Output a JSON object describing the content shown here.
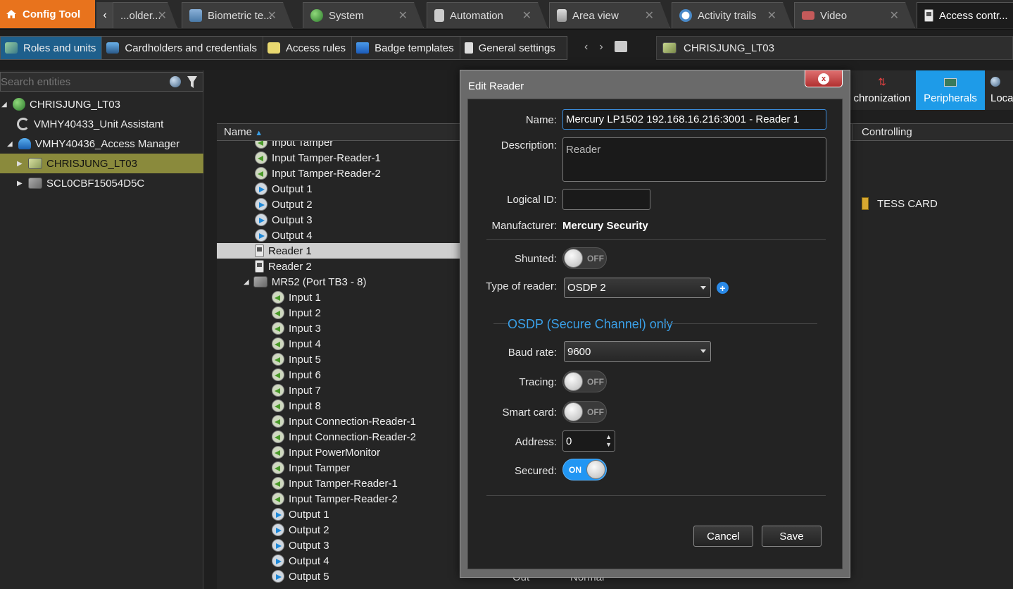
{
  "app": {
    "title": "Config Tool"
  },
  "tabs": [
    {
      "label": "...older...",
      "icon": "folder-icon"
    },
    {
      "label": "Biometric te...",
      "icon": "image-icon"
    },
    {
      "label": "System",
      "icon": "globe-icon"
    },
    {
      "label": "Automation",
      "icon": "automation-icon"
    },
    {
      "label": "Area view",
      "icon": "area-view-icon"
    },
    {
      "label": "Activity trails",
      "icon": "clock-icon"
    },
    {
      "label": "Video",
      "icon": "video-icon"
    },
    {
      "label": "Access contr...",
      "icon": "reader-icon"
    }
  ],
  "toolbar": {
    "items": [
      {
        "label": "Roles and units",
        "active": true
      },
      {
        "label": "Cardholders and credentials"
      },
      {
        "label": "Access rules"
      },
      {
        "label": "Badge templates"
      },
      {
        "label": "General settings"
      }
    ],
    "path": "CHRISJUNG_LT03"
  },
  "sidebar": {
    "search_placeholder": "Search entities",
    "tree": [
      {
        "label": "CHRISJUNG_LT03",
        "icon": "globe-icon",
        "indent": 0,
        "expanded": true
      },
      {
        "label": "VMHY40433_Unit Assistant",
        "icon": "unit-assistant-icon",
        "indent": 1
      },
      {
        "label": "VMHY40436_Access Manager",
        "icon": "access-manager-icon",
        "indent": 1,
        "expanded": true
      },
      {
        "label": "CHRISJUNG_LT03",
        "icon": "unit-icon",
        "indent": 2,
        "selected": true
      },
      {
        "label": "SCL0CBF15054D5C",
        "icon": "unit-icon",
        "indent": 2
      }
    ]
  },
  "righttabs": [
    {
      "label": "chronization",
      "icon": "sync-icon"
    },
    {
      "label": "Peripherals",
      "icon": "peripherals-icon",
      "active": true
    },
    {
      "label": "Loca",
      "icon": "location-icon"
    }
  ],
  "list": {
    "col_name": "Name",
    "col_controlling": "Controlling",
    "controlling_value": "TESS CARD",
    "rows": [
      {
        "label": "Input Tamper",
        "type": "in",
        "indent": 0
      },
      {
        "label": "Input Tamper-Reader-1",
        "type": "in",
        "indent": 0
      },
      {
        "label": "Input Tamper-Reader-2",
        "type": "in",
        "indent": 0
      },
      {
        "label": "Output 1",
        "type": "out",
        "indent": 0
      },
      {
        "label": "Output 2",
        "type": "out",
        "indent": 0
      },
      {
        "label": "Output 3",
        "type": "out",
        "indent": 0
      },
      {
        "label": "Output 4",
        "type": "out",
        "indent": 0
      },
      {
        "label": "Reader 1",
        "type": "rd",
        "indent": 0,
        "selected": true
      },
      {
        "label": "Reader 2",
        "type": "rd",
        "indent": 0
      },
      {
        "label": "MR52 (Port TB3 - 8)",
        "type": "mod",
        "indent": 0,
        "expander": true
      },
      {
        "label": "Input 1",
        "type": "in",
        "indent": 1
      },
      {
        "label": "Input 2",
        "type": "in",
        "indent": 1
      },
      {
        "label": "Input 3",
        "type": "in",
        "indent": 1
      },
      {
        "label": "Input 4",
        "type": "in",
        "indent": 1
      },
      {
        "label": "Input 5",
        "type": "in",
        "indent": 1
      },
      {
        "label": "Input 6",
        "type": "in",
        "indent": 1
      },
      {
        "label": "Input 7",
        "type": "in",
        "indent": 1
      },
      {
        "label": "Input 8",
        "type": "in",
        "indent": 1
      },
      {
        "label": "Input Connection-Reader-1",
        "type": "in",
        "indent": 1
      },
      {
        "label": "Input Connection-Reader-2",
        "type": "in",
        "indent": 1
      },
      {
        "label": "Input PowerMonitor",
        "type": "in",
        "indent": 1
      },
      {
        "label": "Input Tamper",
        "type": "in",
        "indent": 1
      },
      {
        "label": "Input Tamper-Reader-1",
        "type": "in",
        "indent": 1
      },
      {
        "label": "Input Tamper-Reader-2",
        "type": "in",
        "indent": 1
      },
      {
        "label": "Output 1",
        "type": "out",
        "indent": 1
      },
      {
        "label": "Output 2",
        "type": "out",
        "indent": 1
      },
      {
        "label": "Output 3",
        "type": "out",
        "indent": 1
      },
      {
        "label": "Output 4",
        "type": "out",
        "indent": 1
      },
      {
        "label": "Output 5",
        "type": "out",
        "indent": 1
      }
    ],
    "partial_cells": [
      {
        "label": "Out"
      },
      {
        "label": "Normal"
      }
    ]
  },
  "dialog": {
    "title": "Edit Reader",
    "close_label": "x",
    "name_label": "Name:",
    "name_value": "Mercury LP1502 192.168.16.216:3001 - Reader 1",
    "description_label": "Description:",
    "description_value": "Reader",
    "logical_id_label": "Logical ID:",
    "logical_id_value": "",
    "manufacturer_label": "Manufacturer:",
    "manufacturer_value": "Mercury Security",
    "shunted_label": "Shunted:",
    "shunted_state": "OFF",
    "type_label": "Type of reader:",
    "type_value": "OSDP 2",
    "osdp_header": "OSDP (Secure Channel) only",
    "baud_label": "Baud rate:",
    "baud_value": "9600",
    "tracing_label": "Tracing:",
    "tracing_state": "OFF",
    "smartcard_label": "Smart card:",
    "smartcard_state": "OFF",
    "address_label": "Address:",
    "address_value": "0",
    "secured_label": "Secured:",
    "secured_state": "ON",
    "cancel_label": "Cancel",
    "save_label": "Save"
  },
  "colors": {
    "accent": "#2196f3",
    "app_orange": "#e8731d",
    "selected_tree": "#8a8a3c",
    "osdp_header": "#3aa0e8"
  }
}
